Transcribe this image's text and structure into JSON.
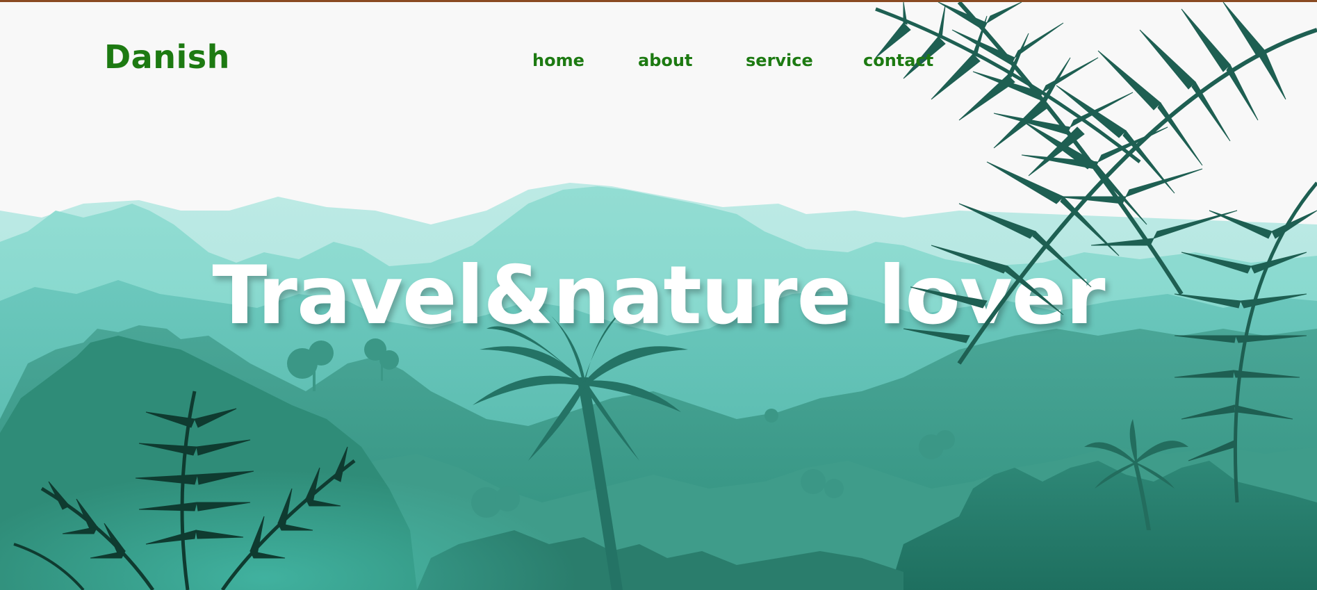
{
  "brand": {
    "name": "Danish"
  },
  "nav": {
    "items": [
      {
        "label": "home"
      },
      {
        "label": "about"
      },
      {
        "label": "service"
      },
      {
        "label": "contact"
      }
    ]
  },
  "hero": {
    "title": "Travel&nature lover"
  },
  "colors": {
    "brand_green": "#1d7a12",
    "page_bg": "#f8f8f8",
    "top_border": "#8a4a22",
    "hero_text": "#ffffff",
    "mountain_far": "#b3e6e1",
    "mountain_mid": "#8fdbd2",
    "jungle_mid": "#5cc2b8",
    "jungle_dark": "#2f8f7c",
    "foliage_dark": "#1e5f52",
    "fern_dark": "#0f3b30"
  }
}
